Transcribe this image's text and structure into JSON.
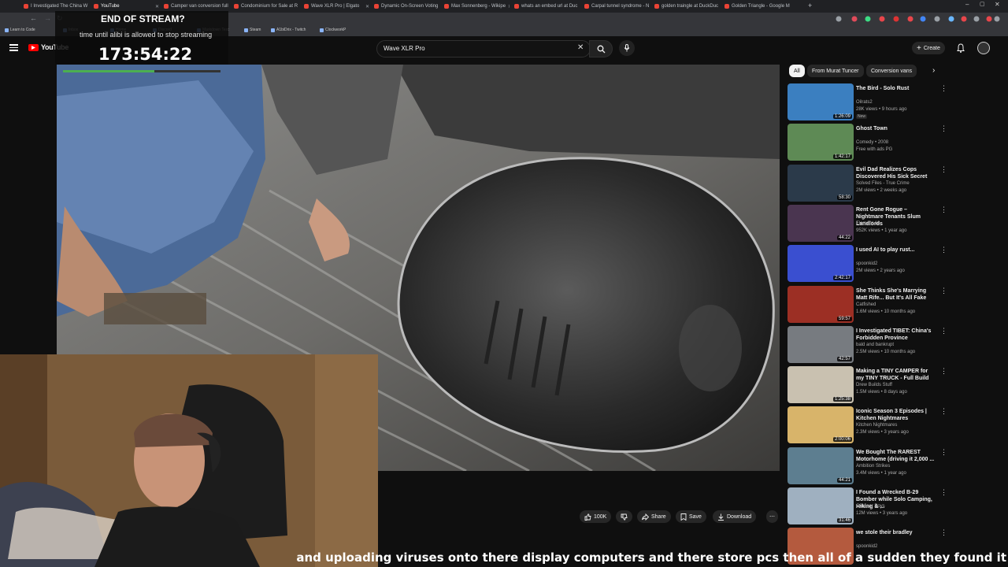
{
  "browser": {
    "tabs": [
      {
        "label": "I Investigated The China W",
        "active": false
      },
      {
        "label": "YouTube",
        "active": true
      },
      {
        "label": "Camper van conversion full",
        "active": false
      },
      {
        "label": "Condominium for Sale at R",
        "active": false
      },
      {
        "label": "Wave XLR Pro | Elgato",
        "active": false
      },
      {
        "label": "Dynamic On-Screen Voting",
        "active": false
      },
      {
        "label": "Max Sonnenberg - Wikipe",
        "active": false
      },
      {
        "label": "whats an embed url at Duc",
        "active": false
      },
      {
        "label": "Carpal tunnel syndrome - N",
        "active": false
      },
      {
        "label": "golden traingle at DuckDuc",
        "active": false
      },
      {
        "label": "Golden Triangle - Google M",
        "active": false
      }
    ],
    "bookmarks": [
      "Learn to Code",
      "Inbox",
      "Home",
      "Discord",
      "Markdown Text",
      "Steam",
      "A1biDrix - Twitch",
      "ClockworkP"
    ]
  },
  "overlay": {
    "title": "END OF STREAM?",
    "subtitle": "time until alibi is allowed to stop streaming",
    "timer": "173:54:22",
    "progress": 0.58
  },
  "youtube": {
    "logo_text": "YouTube",
    "search_value": "Wave XLR Pro",
    "create_label": "Create"
  },
  "chips": [
    "All",
    "From Murat Tuncer",
    "Conversion vans"
  ],
  "recommendations": [
    {
      "title": "The Bird - Solo Rust",
      "channel": "Oilrats2",
      "meta": "28K views • 9 hours ago",
      "badge": "New",
      "duration": "1:26:09",
      "bg": "#3b7fc0"
    },
    {
      "title": "Ghost Town",
      "channel": "Comedy • 2008",
      "meta": "Free with ads  PG",
      "badge": "",
      "duration": "1:42:17",
      "bg": "#5e8a55"
    },
    {
      "title": "Evil Dad Realizes Cops Discovered His Sick Secret",
      "channel": "Solved Files - True Crime",
      "meta": "2M views • 2 weeks ago",
      "badge": "",
      "duration": "58:30",
      "bg": "#2b3a4a"
    },
    {
      "title": "Rent Gone Rogue – Nightmare Tenants Slum Landlords",
      "channel": "Element 18",
      "meta": "952K views • 1 year ago",
      "badge": "",
      "duration": "44:22",
      "bg": "#4a3550"
    },
    {
      "title": "I used AI to play rust...",
      "channel": "spoonkid2",
      "meta": "2M views • 2 years ago",
      "badge": "",
      "duration": "2:42:17",
      "bg": "#3a4fd0"
    },
    {
      "title": "She Thinks She's Marrying Matt Rife... But It's All Fake",
      "channel": "Catfished",
      "meta": "1.6M views • 10 months ago",
      "badge": "",
      "duration": "59:57",
      "bg": "#9c2f24"
    },
    {
      "title": "I Investigated TIBET: China's Forbidden Province",
      "channel": "bald and bankrupt",
      "meta": "2.5M views • 10 months ago",
      "badge": "",
      "duration": "42:57",
      "bg": "#777b80"
    },
    {
      "title": "Making a TINY CAMPER for my TINY TRUCK - Full Build",
      "channel": "Drew Builds Stuff",
      "meta": "1.5M views • 8 days ago",
      "badge": "",
      "duration": "1:25:38",
      "bg": "#c9c1b0"
    },
    {
      "title": "Iconic Season 3 Episodes | Kitchen Nightmares",
      "channel": "Kitchen Nightmares",
      "meta": "2.3M views • 3 years ago",
      "badge": "",
      "duration": "2:00:06",
      "bg": "#d8b46a"
    },
    {
      "title": "We Bought The RAREST Motorhome (driving it 2,000 ...",
      "channel": "Ambition Strikes",
      "meta": "3.4M views • 1 year ago",
      "badge": "",
      "duration": "44:21",
      "bg": "#5d7e90"
    },
    {
      "title": "I Found a Wrecked B-29 Bomber while Solo Camping, Hiking & ...",
      "channel": "Outdoor Boys",
      "meta": "12M views • 3 years ago",
      "badge": "",
      "duration": "31:46",
      "bg": "#9fb0c0"
    },
    {
      "title": "we stole their bradley",
      "channel": "spoonkid2",
      "meta": "",
      "badge": "",
      "duration": "",
      "bg": "#b45a3e"
    }
  ],
  "actions": {
    "likes": "100K",
    "share": "Share",
    "save": "Save",
    "download": "Download"
  },
  "caption": "and uploading viruses onto there display computers and there store pcs then all of a sudden they found it",
  "colors": {
    "bg": "#0f0f0f",
    "accent_red": "#ff0000",
    "progress_green": "#4caf50"
  }
}
